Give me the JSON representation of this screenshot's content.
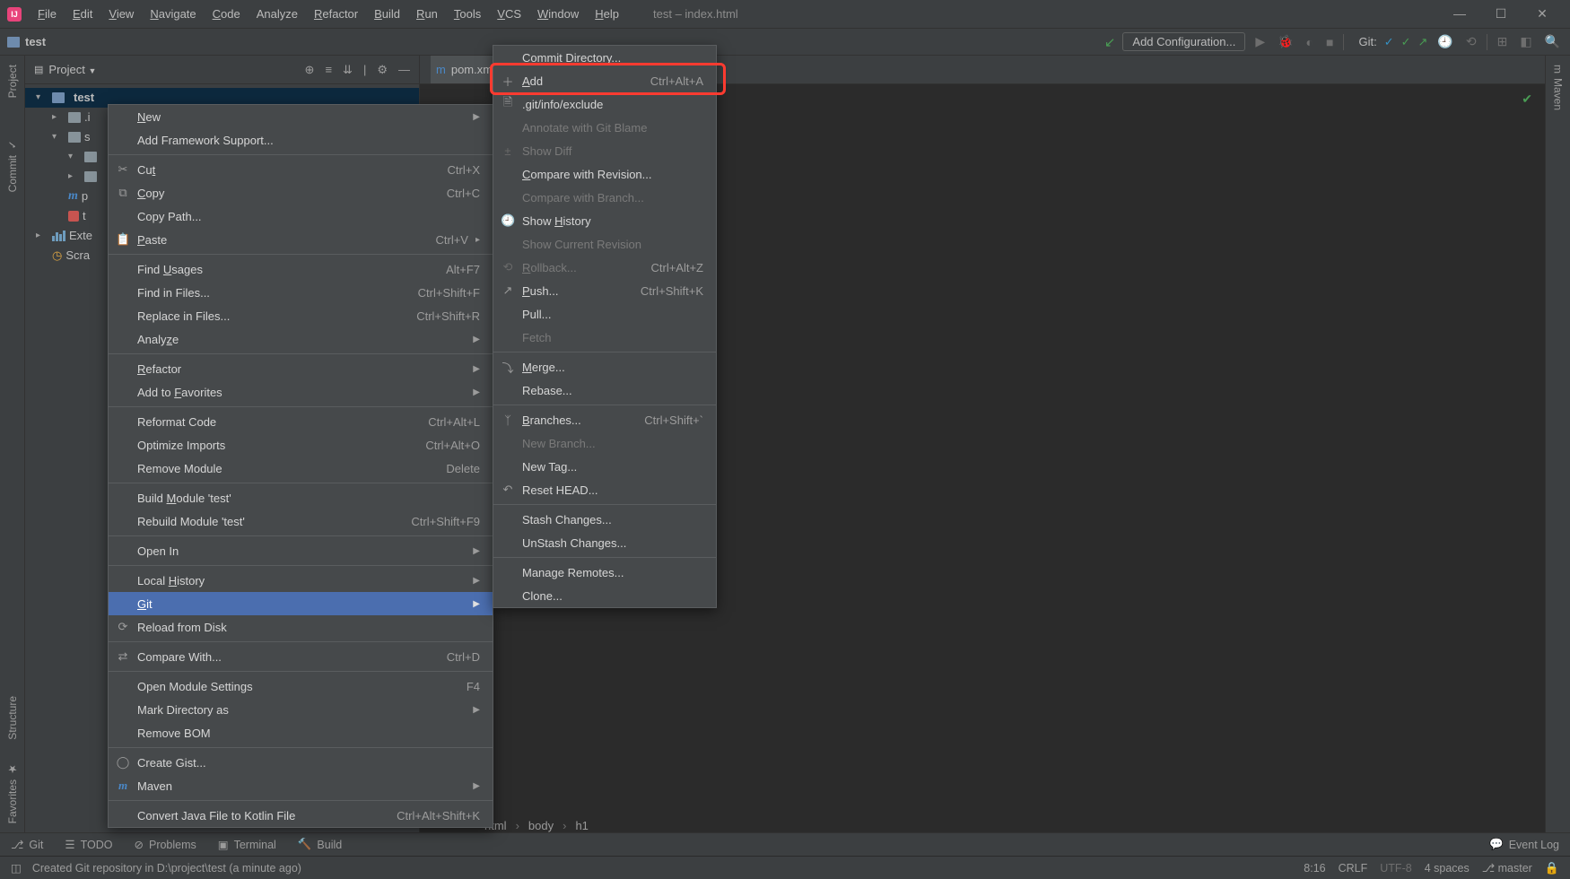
{
  "title": "test – index.html",
  "menubar": [
    "File",
    "Edit",
    "View",
    "Navigate",
    "Code",
    "Analyze",
    "Refactor",
    "Build",
    "Run",
    "Tools",
    "VCS",
    "Window",
    "Help"
  ],
  "menubar_u": [
    "F",
    "E",
    "V",
    "N",
    "C",
    null,
    "R",
    "B",
    "R",
    "T",
    "V",
    "W",
    "H"
  ],
  "window_controls": {
    "min": "—",
    "max": "☐",
    "close": "✕"
  },
  "nav": {
    "project_name": "test"
  },
  "toolbar": {
    "add_config": "Add Configuration...",
    "git_label": "Git:"
  },
  "left_sidebar": {
    "project": "Project",
    "commit": "Commit",
    "structure": "Structure",
    "favorites": "Favorites"
  },
  "right_sidebar": {
    "maven": "Maven"
  },
  "project_panel": {
    "title": "Project",
    "tree": {
      "root": "test",
      "c1": ".i",
      "c2": "s",
      "c3": "p",
      "c4": "t",
      "ext": "Exte",
      "scratches": "Scra"
    }
  },
  "editor_tab": {
    "file": "pom.xm"
  },
  "ctx1": [
    {
      "t": "item",
      "label": "New",
      "sub": true,
      "u": "N"
    },
    {
      "t": "item",
      "label": "Add Framework Support..."
    },
    {
      "t": "sep"
    },
    {
      "t": "item",
      "label": "Cut",
      "short": "Ctrl+X",
      "icon": "✂",
      "u": "t"
    },
    {
      "t": "item",
      "label": "Copy",
      "short": "Ctrl+C",
      "icon": "⧉",
      "u": "C"
    },
    {
      "t": "item",
      "label": "Copy Path..."
    },
    {
      "t": "item",
      "label": "Paste",
      "short": "Ctrl+V",
      "icon": "📋",
      "u": "P",
      "subplus": true
    },
    {
      "t": "sep"
    },
    {
      "t": "item",
      "label": "Find Usages",
      "short": "Alt+F7",
      "u": "U"
    },
    {
      "t": "item",
      "label": "Find in Files...",
      "short": "Ctrl+Shift+F"
    },
    {
      "t": "item",
      "label": "Replace in Files...",
      "short": "Ctrl+Shift+R"
    },
    {
      "t": "item",
      "label": "Analyze",
      "sub": true,
      "u": "z"
    },
    {
      "t": "sep"
    },
    {
      "t": "item",
      "label": "Refactor",
      "sub": true,
      "u": "R"
    },
    {
      "t": "item",
      "label": "Add to Favorites",
      "sub": true,
      "u": "F"
    },
    {
      "t": "sep"
    },
    {
      "t": "item",
      "label": "Reformat Code",
      "short": "Ctrl+Alt+L"
    },
    {
      "t": "item",
      "label": "Optimize Imports",
      "short": "Ctrl+Alt+O"
    },
    {
      "t": "item",
      "label": "Remove Module",
      "short": "Delete"
    },
    {
      "t": "sep"
    },
    {
      "t": "item",
      "label": "Build Module 'test'",
      "u": "M"
    },
    {
      "t": "item",
      "label": "Rebuild Module 'test'",
      "short": "Ctrl+Shift+F9"
    },
    {
      "t": "sep"
    },
    {
      "t": "item",
      "label": "Open In",
      "sub": true
    },
    {
      "t": "sep"
    },
    {
      "t": "item",
      "label": "Local History",
      "sub": true,
      "u": "H"
    },
    {
      "t": "item",
      "label": "Git",
      "sub": true,
      "selected": true,
      "u": "G"
    },
    {
      "t": "item",
      "label": "Reload from Disk",
      "icon": "⟳"
    },
    {
      "t": "sep"
    },
    {
      "t": "item",
      "label": "Compare With...",
      "short": "Ctrl+D",
      "icon": "⇄"
    },
    {
      "t": "sep"
    },
    {
      "t": "item",
      "label": "Open Module Settings",
      "short": "F4"
    },
    {
      "t": "item",
      "label": "Mark Directory as",
      "sub": true
    },
    {
      "t": "item",
      "label": "Remove BOM"
    },
    {
      "t": "sep"
    },
    {
      "t": "item",
      "label": "Create Gist...",
      "icon": "◯"
    },
    {
      "t": "item",
      "label": "Maven",
      "icon": "m",
      "sub": true
    },
    {
      "t": "sep"
    },
    {
      "t": "item",
      "label": "Convert Java File to Kotlin File",
      "short": "Ctrl+Alt+Shift+K"
    }
  ],
  "ctx2": [
    {
      "t": "item",
      "label": "Commit Directory...",
      "u": "C"
    },
    {
      "t": "item",
      "label": "Add",
      "short": "Ctrl+Alt+A",
      "icon": "＋",
      "u": "A"
    },
    {
      "t": "item",
      "label": ".git/info/exclude",
      "icon": "🗎"
    },
    {
      "t": "item",
      "label": "Annotate with Git Blame",
      "disabled": true
    },
    {
      "t": "item",
      "label": "Show Diff",
      "disabled": true,
      "icon": "±"
    },
    {
      "t": "item",
      "label": "Compare with Revision...",
      "u": "C"
    },
    {
      "t": "item",
      "label": "Compare with Branch...",
      "disabled": true
    },
    {
      "t": "item",
      "label": "Show History",
      "icon": "🕘",
      "u": "H"
    },
    {
      "t": "item",
      "label": "Show Current Revision",
      "disabled": true
    },
    {
      "t": "item",
      "label": "Rollback...",
      "short": "Ctrl+Alt+Z",
      "disabled": true,
      "icon": "⟲",
      "u": "R"
    },
    {
      "t": "item",
      "label": "Push...",
      "short": "Ctrl+Shift+K",
      "icon": "↗",
      "u": "P"
    },
    {
      "t": "item",
      "label": "Pull..."
    },
    {
      "t": "item",
      "label": "Fetch",
      "disabled": true
    },
    {
      "t": "sep"
    },
    {
      "t": "item",
      "label": "Merge...",
      "icon": "⤵",
      "u": "M"
    },
    {
      "t": "item",
      "label": "Rebase..."
    },
    {
      "t": "sep"
    },
    {
      "t": "item",
      "label": "Branches...",
      "short": "Ctrl+Shift+`",
      "icon": "ᛉ",
      "u": "B"
    },
    {
      "t": "item",
      "label": "New Branch...",
      "disabled": true
    },
    {
      "t": "item",
      "label": "New Tag..."
    },
    {
      "t": "item",
      "label": "Reset HEAD...",
      "icon": "↶"
    },
    {
      "t": "sep"
    },
    {
      "t": "item",
      "label": "Stash Changes..."
    },
    {
      "t": "item",
      "label": "UnStash Changes..."
    },
    {
      "t": "sep"
    },
    {
      "t": "item",
      "label": "Manage Remotes..."
    },
    {
      "t": "item",
      "label": "Clone..."
    }
  ],
  "breadcrumb": [
    "html",
    "body",
    "h1"
  ],
  "bottom_tools": {
    "git": "Git",
    "todo": "TODO",
    "problems": "Problems",
    "terminal": "Terminal",
    "build": "Build",
    "event_log": "Event Log"
  },
  "statusbar": {
    "msg": "Created Git repository in D:\\project\\test (a minute ago)",
    "pos": "8:16",
    "crlf": "CRLF",
    "enc": "UTF-8",
    "indent": "4 spaces",
    "branch": "master"
  }
}
